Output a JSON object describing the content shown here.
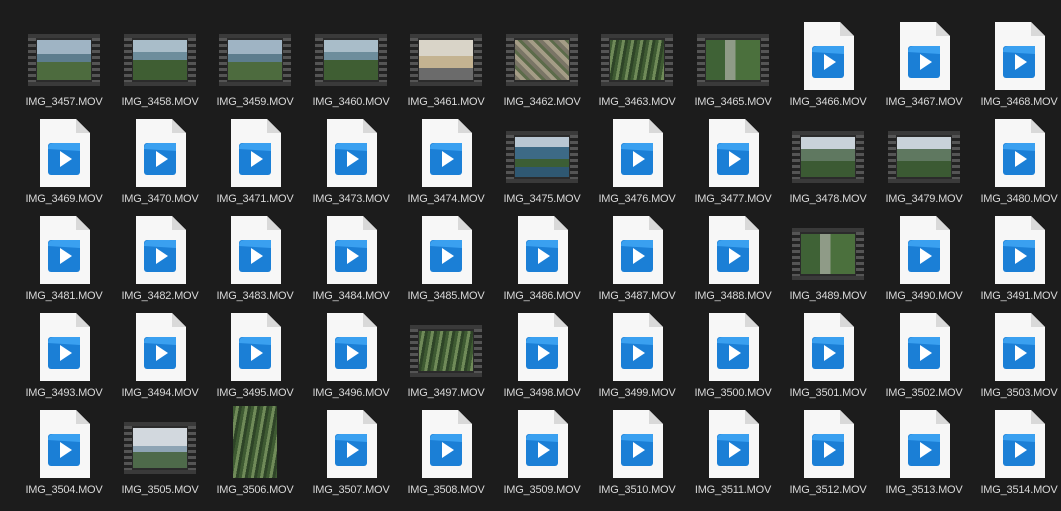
{
  "files": [
    {
      "name": "IMG_3457.MOV",
      "thumb": "film",
      "scene": "sea"
    },
    {
      "name": "IMG_3458.MOV",
      "thumb": "film",
      "scene": "sea-forest"
    },
    {
      "name": "IMG_3459.MOV",
      "thumb": "film",
      "scene": "sea"
    },
    {
      "name": "IMG_3460.MOV",
      "thumb": "film",
      "scene": "sea-forest"
    },
    {
      "name": "IMG_3461.MOV",
      "thumb": "film",
      "scene": "building"
    },
    {
      "name": "IMG_3462.MOV",
      "thumb": "film",
      "scene": "rocks"
    },
    {
      "name": "IMG_3463.MOV",
      "thumb": "film",
      "scene": "forest"
    },
    {
      "name": "IMG_3465.MOV",
      "thumb": "film",
      "scene": "path"
    },
    {
      "name": "IMG_3466.MOV",
      "thumb": "icon"
    },
    {
      "name": "IMG_3467.MOV",
      "thumb": "icon"
    },
    {
      "name": "IMG_3468.MOV",
      "thumb": "icon"
    },
    {
      "name": "IMG_3469.MOV",
      "thumb": "icon"
    },
    {
      "name": "IMG_3470.MOV",
      "thumb": "icon"
    },
    {
      "name": "IMG_3471.MOV",
      "thumb": "icon"
    },
    {
      "name": "IMG_3473.MOV",
      "thumb": "icon"
    },
    {
      "name": "IMG_3474.MOV",
      "thumb": "icon"
    },
    {
      "name": "IMG_3475.MOV",
      "thumb": "film",
      "scene": "lake"
    },
    {
      "name": "IMG_3476.MOV",
      "thumb": "icon"
    },
    {
      "name": "IMG_3477.MOV",
      "thumb": "icon"
    },
    {
      "name": "IMG_3478.MOV",
      "thumb": "film",
      "scene": "valley"
    },
    {
      "name": "IMG_3479.MOV",
      "thumb": "film",
      "scene": "valley"
    },
    {
      "name": "IMG_3480.MOV",
      "thumb": "icon"
    },
    {
      "name": "IMG_3481.MOV",
      "thumb": "icon"
    },
    {
      "name": "IMG_3482.MOV",
      "thumb": "icon"
    },
    {
      "name": "IMG_3483.MOV",
      "thumb": "icon"
    },
    {
      "name": "IMG_3484.MOV",
      "thumb": "icon"
    },
    {
      "name": "IMG_3485.MOV",
      "thumb": "icon"
    },
    {
      "name": "IMG_3486.MOV",
      "thumb": "icon"
    },
    {
      "name": "IMG_3487.MOV",
      "thumb": "icon"
    },
    {
      "name": "IMG_3488.MOV",
      "thumb": "icon"
    },
    {
      "name": "IMG_3489.MOV",
      "thumb": "film",
      "scene": "path"
    },
    {
      "name": "IMG_3490.MOV",
      "thumb": "icon"
    },
    {
      "name": "IMG_3491.MOV",
      "thumb": "icon"
    },
    {
      "name": "IMG_3493.MOV",
      "thumb": "icon"
    },
    {
      "name": "IMG_3494.MOV",
      "thumb": "icon"
    },
    {
      "name": "IMG_3495.MOV",
      "thumb": "icon"
    },
    {
      "name": "IMG_3496.MOV",
      "thumb": "icon"
    },
    {
      "name": "IMG_3497.MOV",
      "thumb": "film",
      "scene": "forest"
    },
    {
      "name": "IMG_3498.MOV",
      "thumb": "icon"
    },
    {
      "name": "IMG_3499.MOV",
      "thumb": "icon"
    },
    {
      "name": "IMG_3500.MOV",
      "thumb": "icon"
    },
    {
      "name": "IMG_3501.MOV",
      "thumb": "icon"
    },
    {
      "name": "IMG_3502.MOV",
      "thumb": "icon"
    },
    {
      "name": "IMG_3503.MOV",
      "thumb": "icon"
    },
    {
      "name": "IMG_3504.MOV",
      "thumb": "icon"
    },
    {
      "name": "IMG_3505.MOV",
      "thumb": "film",
      "scene": "sky"
    },
    {
      "name": "IMG_3506.MOV",
      "thumb": "portrait",
      "scene": "forest"
    },
    {
      "name": "IMG_3507.MOV",
      "thumb": "icon"
    },
    {
      "name": "IMG_3508.MOV",
      "thumb": "icon"
    },
    {
      "name": "IMG_3509.MOV",
      "thumb": "icon"
    },
    {
      "name": "IMG_3510.MOV",
      "thumb": "icon"
    },
    {
      "name": "IMG_3511.MOV",
      "thumb": "icon"
    },
    {
      "name": "IMG_3512.MOV",
      "thumb": "icon"
    },
    {
      "name": "IMG_3513.MOV",
      "thumb": "icon"
    },
    {
      "name": "IMG_3514.MOV",
      "thumb": "icon"
    }
  ],
  "colors": {
    "background": "#1c1c1c",
    "label": "#d8d8d8",
    "icon_blue": "#1b7fd6",
    "icon_blue_dark": "#0f5fb5"
  }
}
